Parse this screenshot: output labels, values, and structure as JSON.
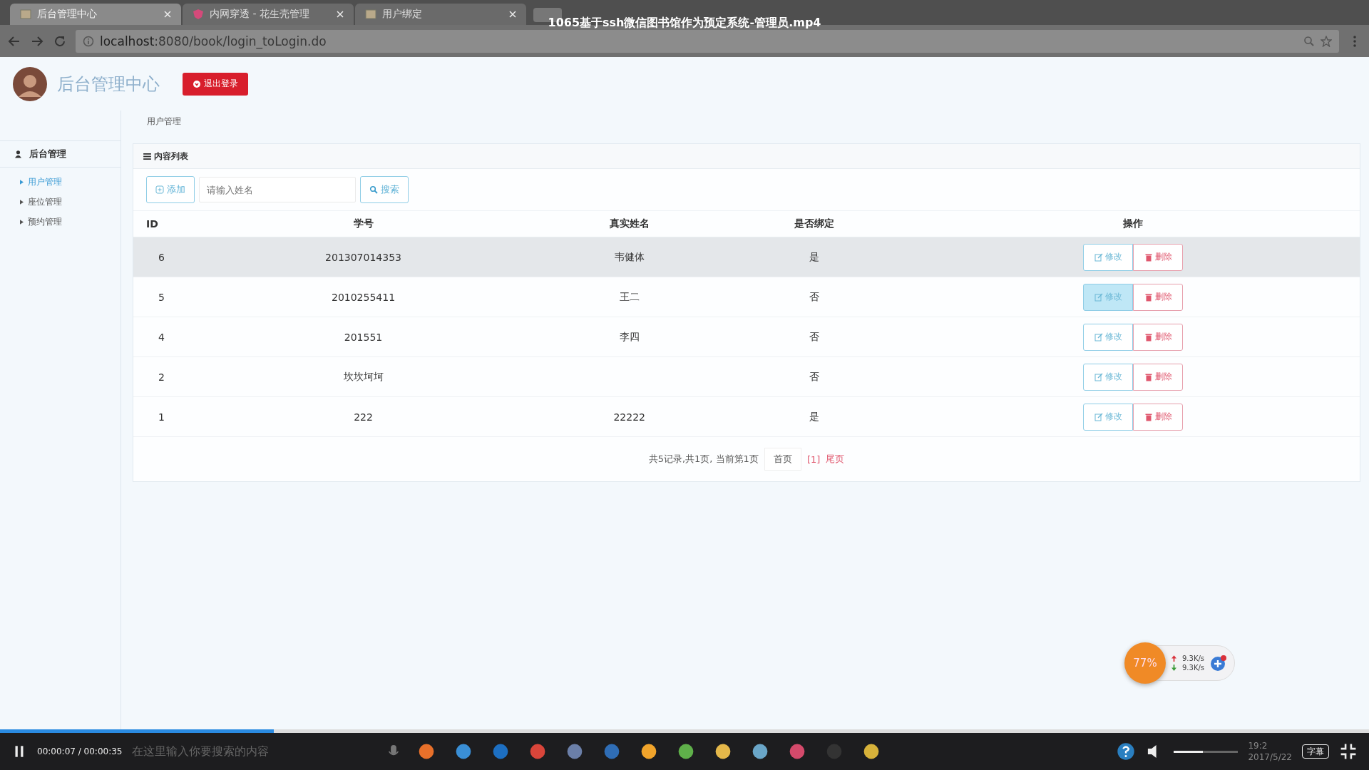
{
  "browser": {
    "tabs": [
      {
        "label": "后台管理中心",
        "selected": true,
        "kind": "image"
      },
      {
        "label": "内网穿透 - 花生壳管理",
        "selected": false,
        "kind": "shield"
      },
      {
        "label": "用户绑定",
        "selected": false,
        "kind": "image"
      }
    ],
    "url_host": "localhost",
    "url_rest": ":8080/book/login_toLogin.do"
  },
  "video": {
    "title": "1065基于ssh微信图书馆作为预定系统-管理员.mp4",
    "time": "00:00:07 / 00:00:35",
    "progress": {
      "level": 0.2
    },
    "search_placeholder": "在这里输入你要搜索的内容",
    "volume": {
      "level": 0.45
    },
    "subtitle_button": "字幕",
    "clock": "19:2",
    "date": "2017/5/22"
  },
  "header": {
    "title": "后台管理中心",
    "logout_button": "退出登录"
  },
  "breadcrumb": "用户管理",
  "sidebar": {
    "section": "后台管理",
    "items": [
      {
        "label": "用户管理",
        "selected": true
      },
      {
        "label": "座位管理",
        "selected": false
      },
      {
        "label": "预约管理",
        "selected": false
      }
    ]
  },
  "panel": {
    "title": "内容列表",
    "add_button": "添加",
    "search": {
      "placeholder": "请输入姓名"
    },
    "search_button": "搜索"
  },
  "table": {
    "columns": [
      "ID",
      "学号",
      "真实姓名",
      "是否绑定",
      "操作"
    ],
    "rows": [
      {
        "id": "6",
        "student_no": "201307014353",
        "name": "韦健体",
        "bound": "是",
        "edit": "修改",
        "delete": "删除",
        "highlighted": true,
        "edit_active": false
      },
      {
        "id": "5",
        "student_no": "2010255411",
        "name": "王二",
        "bound": "否",
        "edit": "修改",
        "delete": "删除",
        "highlighted": false,
        "edit_active": true
      },
      {
        "id": "4",
        "student_no": "201551",
        "name": "李四",
        "bound": "否",
        "edit": "修改",
        "delete": "删除",
        "highlighted": false,
        "edit_active": false
      },
      {
        "id": "2",
        "student_no": "坎坎坷坷",
        "name": "",
        "bound": "否",
        "edit": "修改",
        "delete": "删除",
        "highlighted": false,
        "edit_active": false
      },
      {
        "id": "1",
        "student_no": "222",
        "name": "22222",
        "bound": "是",
        "edit": "修改",
        "delete": "删除",
        "highlighted": false,
        "edit_active": false
      }
    ]
  },
  "pagination": {
    "summary": "共5记录,共1页, 当前第1页",
    "first": "首页",
    "pages": "[1]",
    "last": "尾页"
  },
  "net_widget": {
    "percent": "77%",
    "up": "9.3K/s",
    "down": "9.3K/s"
  }
}
